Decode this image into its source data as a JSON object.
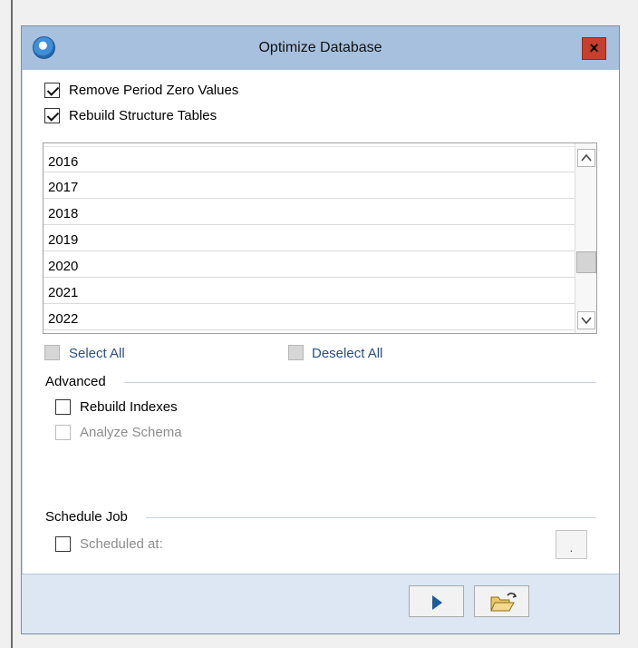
{
  "window": {
    "title": "Optimize Database",
    "close_label": "×"
  },
  "options": {
    "remove_period_zero": {
      "label": "Remove Period Zero Values",
      "checked": true
    },
    "rebuild_structure": {
      "label": "Rebuild Structure Tables",
      "checked": true
    }
  },
  "years": [
    "2016",
    "2017",
    "2018",
    "2019",
    "2020",
    "2021",
    "2022"
  ],
  "selection": {
    "select_all": "Select All",
    "deselect_all": "Deselect All"
  },
  "advanced": {
    "heading": "Advanced",
    "rebuild_indexes": {
      "label": "Rebuild Indexes",
      "checked": false
    },
    "analyze_schema": {
      "label": "Analyze Schema",
      "checked": false
    }
  },
  "schedule": {
    "heading": "Schedule Job",
    "scheduled_at": {
      "label": "Scheduled at:",
      "checked": false
    },
    "browse_label": "."
  },
  "icons": {
    "app": "database-icon",
    "run": "play-icon",
    "open": "folder-open-icon",
    "scroll_up": "chevron-up-icon",
    "scroll_down": "chevron-down-icon"
  },
  "colors": {
    "titlebar": "#a7c0dd",
    "close": "#c7402e",
    "footer": "#dce7f3",
    "accent": "#1f5a9e"
  }
}
